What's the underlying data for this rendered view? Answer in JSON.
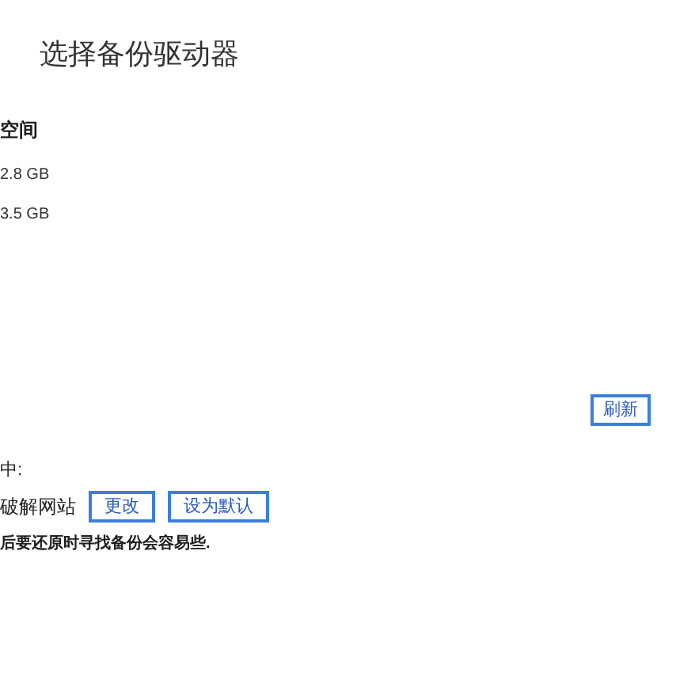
{
  "window": {
    "title": "选择备份驱动器"
  },
  "drive_table": {
    "column_header": "空间",
    "rows": [
      {
        "space": "2.8 GB"
      },
      {
        "space": "3.5 GB"
      }
    ]
  },
  "refresh_button": "刷新",
  "location": {
    "label": "中:",
    "value": "破解网站",
    "buttons": [
      "更改",
      "设为默认"
    ]
  },
  "note": "后要还原时寻找备份会容易些."
}
